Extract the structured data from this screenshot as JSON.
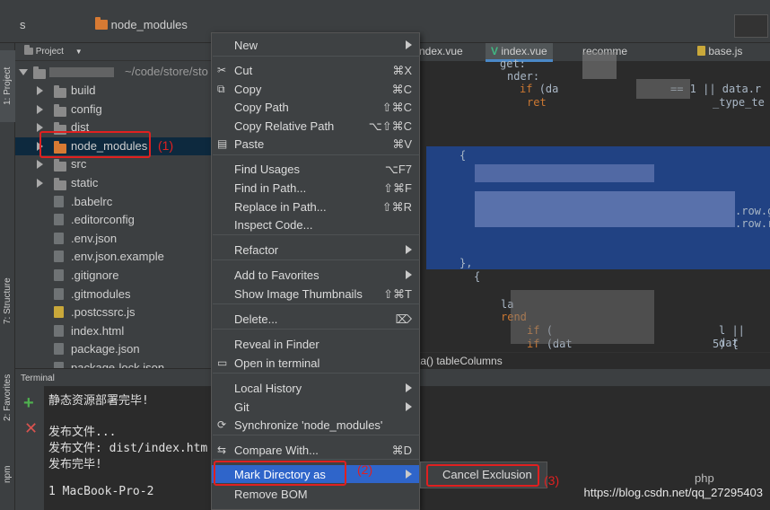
{
  "topbar": {
    "root_crumb": "s",
    "folder_crumb": "node_modules"
  },
  "vtabs": {
    "project": "1: Project",
    "structure": "7: Structure",
    "favorites": "2: Favorites",
    "npm": "npm"
  },
  "project_panel": {
    "header": "Project",
    "root_path": "~/code/store/sto",
    "items": [
      {
        "label": "build",
        "kind": "folder"
      },
      {
        "label": "config",
        "kind": "folder"
      },
      {
        "label": "dist",
        "kind": "folder"
      },
      {
        "label": "node_modules",
        "kind": "folder-excluded"
      },
      {
        "label": "src",
        "kind": "folder"
      },
      {
        "label": "static",
        "kind": "folder"
      },
      {
        "label": ".babelrc",
        "kind": "file"
      },
      {
        "label": ".editorconfig",
        "kind": "file"
      },
      {
        "label": ".env.json",
        "kind": "file"
      },
      {
        "label": ".env.json.example",
        "kind": "file"
      },
      {
        "label": ".gitignore",
        "kind": "file"
      },
      {
        "label": ".gitmodules",
        "kind": "file"
      },
      {
        "label": ".postcssrc.js",
        "kind": "js"
      },
      {
        "label": "index.html",
        "kind": "file"
      },
      {
        "label": "package.json",
        "kind": "file"
      },
      {
        "label": "package-lock.json",
        "kind": "file"
      }
    ]
  },
  "editor": {
    "tabs": [
      "ndex.vue",
      "index.vue",
      "recomme",
      "base.js"
    ],
    "code": {
      "l1": "get:",
      "l2": "nder:",
      "l3_kw": "if",
      "l3": "(da",
      "l3r": "== 1 || data.r",
      "l4_kw": "ret",
      "l4": "_type_te",
      "l5": "{",
      "l6": ".row.g",
      "l7": ".row.re",
      "l8": "},",
      "l9": "{",
      "l10": "la",
      "l11": "rend",
      "l12_kw": "if",
      "l12": "(",
      "l12r": "l || dat",
      "l13_kw": "if",
      "l13": "(dat",
      "l13r": "5) {"
    },
    "status_path": "ta()  tableColumns"
  },
  "terminal": {
    "title": "Terminal",
    "lines": [
      "静态资源部署完毕!",
      "",
      "发布文件...",
      "发布文件: dist/index.htm",
      "发布完毕!",
      "",
      "1        MacBook-Pro-2"
    ]
  },
  "context_menu": {
    "items": [
      {
        "label": "New",
        "shortcut": "",
        "submenu": true,
        "icon": ""
      },
      {
        "label": "Cut",
        "shortcut": "⌘X",
        "submenu": false,
        "icon": "scissors-icon"
      },
      {
        "label": "Copy",
        "shortcut": "⌘C",
        "submenu": false,
        "icon": "copy-icon"
      },
      {
        "label": "Copy Path",
        "shortcut": "⇧⌘C",
        "submenu": false,
        "icon": ""
      },
      {
        "label": "Copy Relative Path",
        "shortcut": "⌥⇧⌘C",
        "submenu": false,
        "icon": ""
      },
      {
        "label": "Paste",
        "shortcut": "⌘V",
        "submenu": false,
        "icon": "paste-icon"
      },
      {
        "label": "Find Usages",
        "shortcut": "⌥F7",
        "submenu": false,
        "icon": ""
      },
      {
        "label": "Find in Path...",
        "shortcut": "⇧⌘F",
        "submenu": false,
        "icon": ""
      },
      {
        "label": "Replace in Path...",
        "shortcut": "⇧⌘R",
        "submenu": false,
        "icon": ""
      },
      {
        "label": "Inspect Code...",
        "shortcut": "",
        "submenu": false,
        "icon": ""
      },
      {
        "label": "Refactor",
        "shortcut": "",
        "submenu": true,
        "icon": ""
      },
      {
        "label": "Add to Favorites",
        "shortcut": "",
        "submenu": true,
        "icon": ""
      },
      {
        "label": "Show Image Thumbnails",
        "shortcut": "⇧⌘T",
        "submenu": false,
        "icon": ""
      },
      {
        "label": "Delete...",
        "shortcut": "⌦",
        "submenu": false,
        "icon": ""
      },
      {
        "label": "Reveal in Finder",
        "shortcut": "",
        "submenu": false,
        "icon": ""
      },
      {
        "label": "Open in terminal",
        "shortcut": "",
        "submenu": false,
        "icon": "terminal-icon"
      },
      {
        "label": "Local History",
        "shortcut": "",
        "submenu": true,
        "icon": ""
      },
      {
        "label": "Git",
        "shortcut": "",
        "submenu": true,
        "icon": ""
      },
      {
        "label": "Synchronize 'node_modules'",
        "shortcut": "",
        "submenu": false,
        "icon": "sync-icon"
      },
      {
        "label": "Compare With...",
        "shortcut": "⌘D",
        "submenu": false,
        "icon": "compare-icon"
      },
      {
        "label": "Mark Directory as",
        "shortcut": "",
        "submenu": true,
        "icon": ""
      },
      {
        "label": "Remove BOM",
        "shortcut": "",
        "submenu": false,
        "icon": ""
      }
    ]
  },
  "submenu": {
    "label": "Cancel Exclusion"
  },
  "annotations": {
    "a1": "(1)",
    "a2": "(2)",
    "a3": "(3)"
  },
  "watermark": "https://blog.csdn.net/qq_27295403",
  "php_mark": "php",
  "colors": {
    "menu_bg": "#3e4143",
    "active": "#2f65ca",
    "annotation": "#e02020",
    "selection": "#214283",
    "excluded_folder": "#d77a33"
  }
}
